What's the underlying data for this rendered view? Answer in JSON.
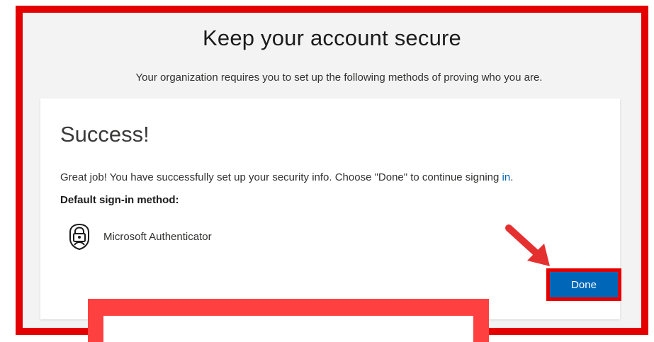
{
  "header": {
    "title": "Keep your account secure",
    "subtitle": "Your organization requires you to set up the following methods of proving who you are."
  },
  "card": {
    "heading": "Success!",
    "message_main": "Great job! You have successfully set up your security info. Choose \"Done\" to continue signing ",
    "message_link": "in",
    "message_end": ".",
    "default_label": "Default sign-in method:",
    "method": {
      "icon": "authenticator-lock-icon",
      "label": "Microsoft Authenticator"
    },
    "done_label": "Done"
  },
  "colors": {
    "accent": "#0067b8",
    "annotation_red": "#e50000",
    "background": "#f3f3f3"
  }
}
